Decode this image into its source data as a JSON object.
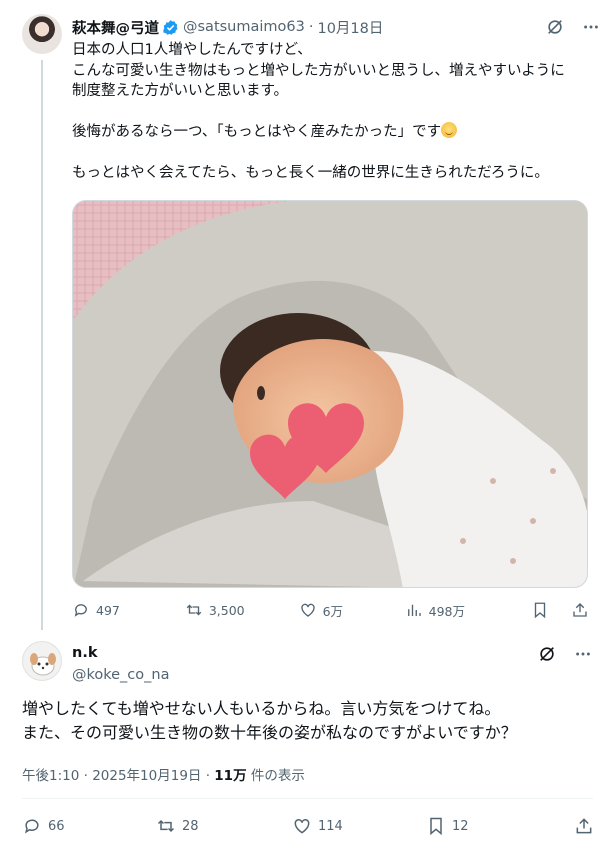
{
  "tweet": {
    "author_name": "萩本舞@弓道",
    "author_handle": "@satsumaimo63",
    "date": "10月18日",
    "lines": [
      "日本の人口1人増やしたんですけど、",
      "こんな可愛い生き物はもっと増やした方がいいと思うし、増えやすいように",
      "制度整えた方がいいと思います。",
      "",
      "後悔があるなら一つ、「もっとはやく産みたかった」です",
      "",
      "もっとはやく会えてたら、もっと長く一緒の世界に生きられただろうに。"
    ],
    "emoji": "pleading-face-emoji",
    "stats": {
      "replies": "497",
      "retweets": "3,500",
      "likes": "6万",
      "views": "498万"
    }
  },
  "reply": {
    "author_name": "n.k",
    "author_handle": "@koke_co_na",
    "lines": [
      "増やしたくても増やせない人もいるからね。言い方気をつけてね。",
      "また、その可愛い生き物の数十年後の姿が私なのですがよいですか？"
    ],
    "time": "午後1:10 · 2025年10月19日 · ",
    "views_count": "11万",
    "views_label": " 件の表示",
    "stats": {
      "replies": "66",
      "retweets": "28",
      "likes": "114",
      "bookmarks": "12"
    }
  },
  "colors": {
    "text": "#0f1419",
    "secondary": "#536471",
    "verified": "#1d9bf0",
    "border": "#cfd9de",
    "heart_sticker": "#ec5f72"
  },
  "icons": [
    "verified-badge-icon",
    "grok-icon",
    "more-icon",
    "reply-icon",
    "retweet-icon",
    "like-icon",
    "views-icon",
    "bookmark-icon",
    "share-icon"
  ]
}
